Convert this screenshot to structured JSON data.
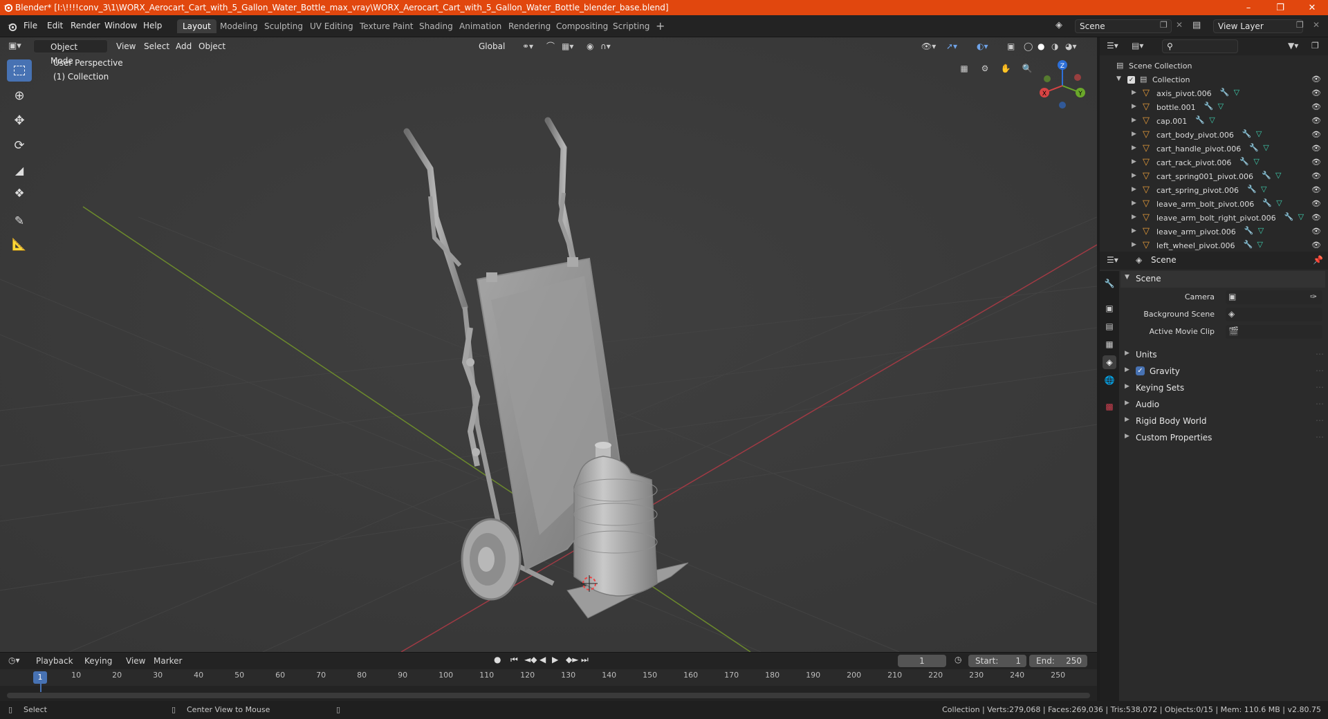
{
  "window": {
    "title": "Blender* [I:\\!!!!conv_3\\1\\WORX_Aerocart_Cart_with_5_Gallon_Water_Bottle_max_vray\\WORX_Aerocart_Cart_with_5_Gallon_Water_Bottle_blender_base.blend]",
    "accent_color": "#e1470e"
  },
  "menu": [
    "File",
    "Edit",
    "Render",
    "Window",
    "Help"
  ],
  "workspaces": [
    "Layout",
    "Modeling",
    "Sculpting",
    "UV Editing",
    "Texture Paint",
    "Shading",
    "Animation",
    "Rendering",
    "Compositing",
    "Scripting"
  ],
  "active_workspace": "Layout",
  "scene_field": "Scene",
  "view_layer_field": "View Layer",
  "viewport": {
    "mode": "Object Mode",
    "menus": [
      "View",
      "Select",
      "Add",
      "Object"
    ],
    "transform_orientation": "Global",
    "perspective_label": "User Perspective",
    "collection_label": "(1) Collection",
    "axis_labels": {
      "x": "X",
      "y": "Y",
      "z": "Z"
    },
    "tools": [
      "select-box-icon",
      "cursor-icon",
      "move-icon",
      "rotate-icon",
      "scale-icon",
      "transform-icon",
      "annotate-icon",
      "measure-icon"
    ]
  },
  "outliner": {
    "root": "Scene Collection",
    "collection": "Collection",
    "items": [
      "axis_pivot.006",
      "bottle.001",
      "cap.001",
      "cart_body_pivot.006",
      "cart_handle_pivot.006",
      "cart_rack_pivot.006",
      "cart_spring001_pivot.006",
      "cart_spring_pivot.006",
      "leave_arm_bolt_pivot.006",
      "leave_arm_bolt_right_pivot.006",
      "leave_arm_pivot.006",
      "left_wheel_pivot.006"
    ]
  },
  "properties": {
    "context": "Scene",
    "panel_title": "Scene",
    "camera_label": "Camera",
    "background_scene_label": "Background Scene",
    "active_movie_clip_label": "Active Movie Clip",
    "subpanels": [
      "Units",
      "Gravity",
      "Keying Sets",
      "Audio",
      "Rigid Body World",
      "Custom Properties"
    ],
    "gravity_checked": true
  },
  "timeline": {
    "menus": [
      "Playback",
      "Keying",
      "View",
      "Marker"
    ],
    "current_frame": "1",
    "start_label": "Start:",
    "start": "1",
    "end_label": "End:",
    "end": "250",
    "ticks": [
      "1",
      "10",
      "20",
      "30",
      "40",
      "50",
      "60",
      "70",
      "80",
      "90",
      "100",
      "110",
      "120",
      "130",
      "140",
      "150",
      "160",
      "170",
      "180",
      "190",
      "200",
      "210",
      "220",
      "230",
      "240",
      "250"
    ]
  },
  "status": {
    "left": "Select",
    "middle": "Center View to Mouse",
    "right": "Collection | Verts:279,068 | Faces:269,036 | Tris:538,072 | Objects:0/15 | Mem: 110.6 MB | v2.80.75"
  }
}
